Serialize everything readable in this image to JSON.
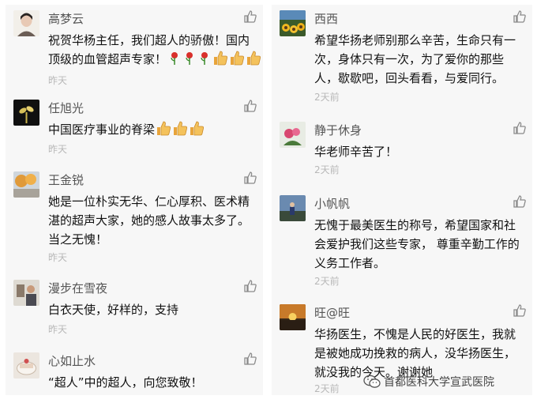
{
  "left_comments": [
    {
      "user": "高梦云",
      "lines": [
        "祝贺华杨主任，我们超人的骄傲！国内",
        "顶级的血管超声专家！"
      ],
      "emoji_after_last_line": [
        "rose",
        "rose",
        "rose",
        "thumbs-up",
        "thumbs-up",
        "thumbs-up"
      ],
      "time": "昨天"
    },
    {
      "user": "任旭光",
      "lines": [
        "中国医疗事业的脊梁"
      ],
      "emoji_after_last_line": [
        "thumbs-up",
        "thumbs-up",
        "thumbs-up"
      ],
      "time": "昨天"
    },
    {
      "user": "王金锐",
      "lines": [
        "她是一位朴实无华、仁心厚积、医术精",
        "湛的超声大家，她的感人故事太多了。",
        "当之无愧！"
      ],
      "emoji_after_last_line": [],
      "time": "昨天"
    },
    {
      "user": "漫步在雪夜",
      "lines": [
        "白衣天使，好样的，支持"
      ],
      "emoji_after_last_line": [],
      "time": "昨天"
    },
    {
      "user": "心如止水",
      "lines": [
        "“超人”中的超人，向您致敬！"
      ],
      "emoji_after_last_line": [],
      "time": "昨天"
    }
  ],
  "right_comments": [
    {
      "user": "西西",
      "lines": [
        "希望华扬老师别那么辛苦，生命只有一",
        "次，身体只有一次，为了爱你的那些",
        "人，歇歇吧，回头看看，与爱同行。"
      ],
      "time": "2天前"
    },
    {
      "user": "静于休身",
      "lines": [
        "华老师辛苦了！"
      ],
      "time": "2天前"
    },
    {
      "user": "小帆帆",
      "lines": [
        "无愧于最美医生的称号，希望国家和社",
        "会爱护我们这些专家， 尊重辛勤工作的",
        "义务工作者。"
      ],
      "time": "2天前"
    },
    {
      "user": "旺@旺",
      "lines": [
        "华扬医生，不愧是人民的好医生，我就",
        "是被她成功挽救的病人，没华扬医生，",
        "就没我的今天。谢谢她"
      ],
      "time": "2天前"
    }
  ],
  "watermark": {
    "text": "首都医科大学宣武医院",
    "icon": "wechat-icon"
  },
  "colors": {
    "panel_bg": "#f7f7f7",
    "name": "#555555",
    "text": "#111111",
    "time": "#b8b8b8",
    "like_icon": "#8a8a8a"
  }
}
